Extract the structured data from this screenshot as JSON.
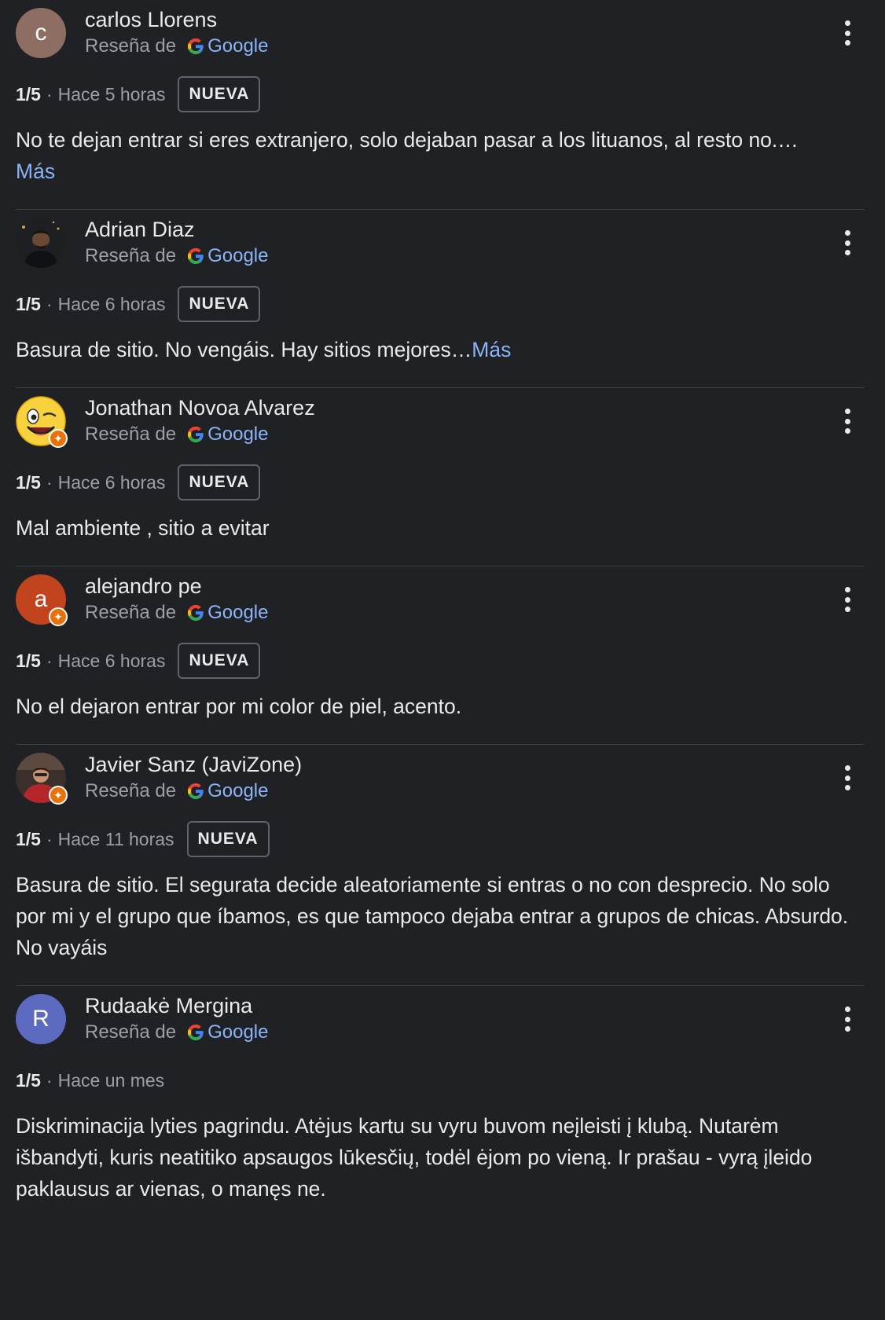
{
  "source_prefix": "Reseña de",
  "source_name": "Google",
  "more_label": "Más",
  "colors": {
    "background": "#202124",
    "text": "#e8eaed",
    "muted": "#9aa0a6",
    "link": "#8ab4f8",
    "divider": "#3c4043",
    "local_guide_badge": "#e8710a"
  },
  "reviews": [
    {
      "author": "carlos Llorens",
      "avatar_letter": "c",
      "avatar_color": "#8d6e63",
      "avatar_kind": "letter",
      "local_guide": false,
      "rating": "1/5",
      "time": "Hace 5 horas",
      "badge": "NUEVA",
      "text": "No te dejan entrar si eres extranjero, solo dejaban pasar a los lituanos, al resto no.…",
      "more": "Más",
      "more_inline": false
    },
    {
      "author": "Adrian Diaz",
      "avatar_kind": "photo-dark-person",
      "local_guide": false,
      "rating": "1/5",
      "time": "Hace 6 horas",
      "badge": "NUEVA",
      "text": "Basura de sitio. No vengáis. Hay sitios mejores…",
      "more": "Más",
      "more_inline": true
    },
    {
      "author": "Jonathan Novoa Alvarez",
      "avatar_kind": "winking-emoji",
      "local_guide": true,
      "rating": "1/5",
      "time": "Hace 6 horas",
      "badge": "NUEVA",
      "text": "Mal ambiente , sitio a evitar",
      "more": "",
      "more_inline": false
    },
    {
      "author": "alejandro pe",
      "avatar_letter": "a",
      "avatar_color": "#c1441e",
      "avatar_kind": "letter",
      "local_guide": true,
      "rating": "1/5",
      "time": "Hace 6 horas",
      "badge": "NUEVA",
      "text": "No el dejaron entrar por mi color de piel, acento.",
      "more": "",
      "more_inline": false
    },
    {
      "author": "Javier Sanz (JaviZone)",
      "avatar_kind": "photo-red-person",
      "local_guide": true,
      "rating": "1/5",
      "time": "Hace 11 horas",
      "badge": "NUEVA",
      "text": "Basura de sitio. El segurata decide aleatoriamente si entras o no con desprecio. No solo por mi y el grupo que íbamos, es que tampoco dejaba entrar a grupos de chicas. Absurdo. No vayáis",
      "more": "",
      "more_inline": false
    },
    {
      "author": "Rudaakė Mergina",
      "avatar_letter": "R",
      "avatar_color": "#5c6bc0",
      "avatar_kind": "letter",
      "local_guide": false,
      "rating": "1/5",
      "time": "Hace un mes",
      "badge": "",
      "text": "Diskriminacija lyties pagrindu. Atėjus kartu su vyru buvom neįleisti į klubą. Nutarėm išbandyti, kuris neatitiko apsaugos lūkesčių, todėl ėjom po vieną. Ir prašau - vyrą įleido paklausus ar vienas, o manęs ne.",
      "more": "",
      "more_inline": false
    }
  ]
}
